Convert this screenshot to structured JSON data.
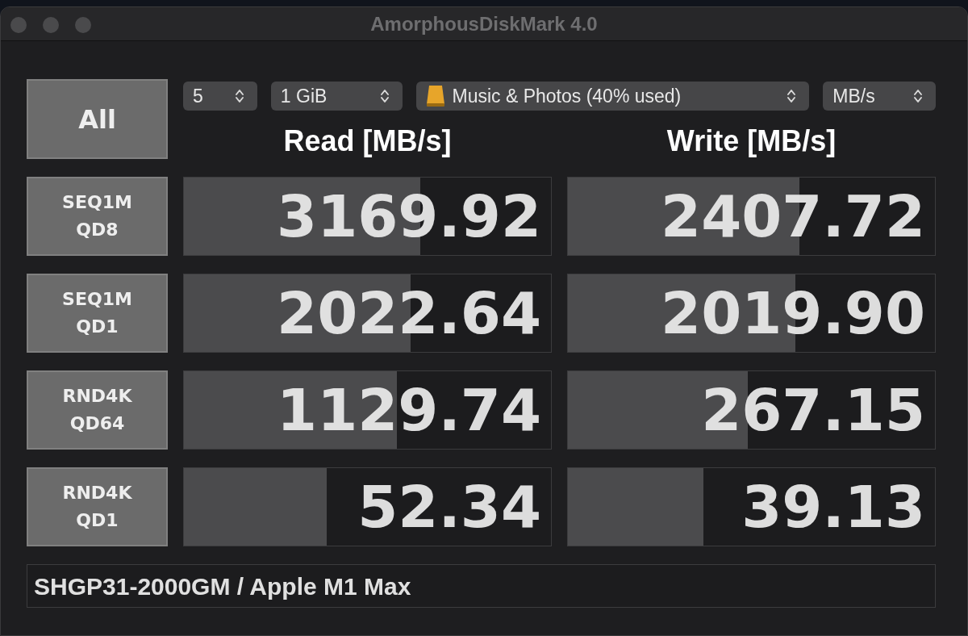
{
  "window": {
    "title": "AmorphousDiskMark 4.0"
  },
  "all_button": "All",
  "selects": [
    {
      "kind": "plain",
      "value": "5"
    },
    {
      "kind": "plain",
      "value": "1 GiB"
    },
    {
      "kind": "drive",
      "value": "Music & Photos (40% used)"
    },
    {
      "kind": "plain",
      "value": "MB/s"
    }
  ],
  "headers": [
    "Read [MB/s]",
    "Write [MB/s]"
  ],
  "rows": [
    {
      "label": "SEQ1M\nQD8",
      "read": {
        "value": "3169.92",
        "level": 0.645
      },
      "write": {
        "value": "2407.72",
        "level": 0.63
      }
    },
    {
      "label": "SEQ1M\nQD1",
      "read": {
        "value": "2022.64",
        "level": 0.617
      },
      "write": {
        "value": "2019.90",
        "level": 0.62
      }
    },
    {
      "label": "RND4K\nQD64",
      "read": {
        "value": "1129.74",
        "level": 0.58
      },
      "write": {
        "value": "267.15",
        "level": 0.49
      }
    },
    {
      "label": "RND4K\nQD1",
      "read": {
        "value": "52.34",
        "level": 0.39
      },
      "write": {
        "value": "39.13",
        "level": 0.37
      }
    }
  ],
  "footer": "SHGP31-2000GM / Apple M1 Max"
}
